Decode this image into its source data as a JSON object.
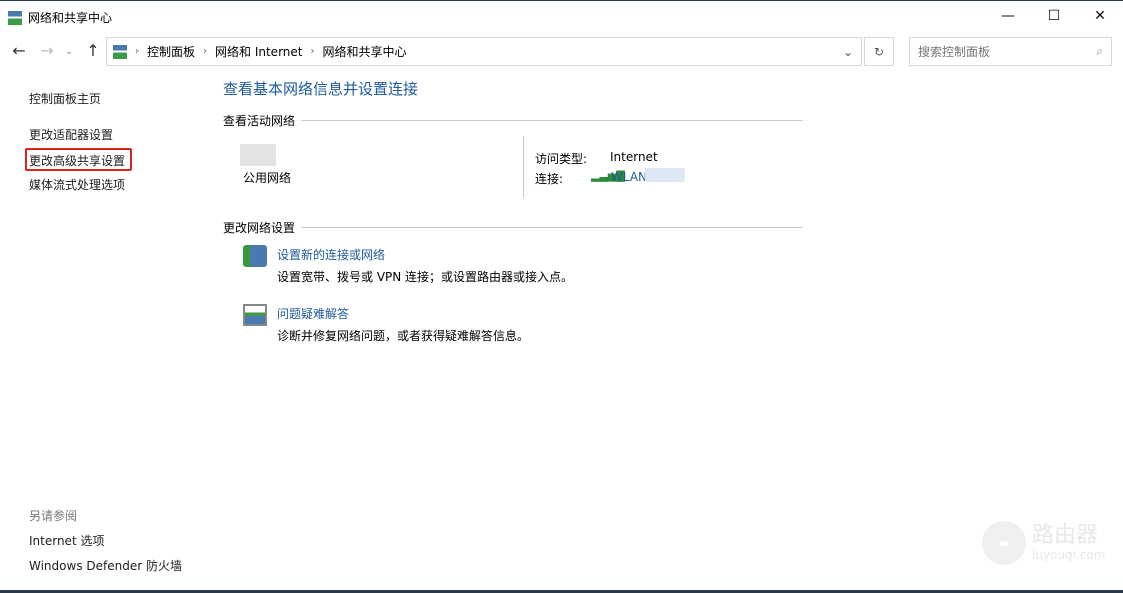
{
  "window": {
    "title": "网络和共享中心",
    "minimize": "—",
    "maximize": "☐",
    "close": "✕"
  },
  "address": {
    "crumbs": [
      "控制面板",
      "网络和 Internet",
      "网络和共享中心"
    ],
    "search_placeholder": "搜索控制面板"
  },
  "sidebar": {
    "items": [
      "控制面板主页",
      "更改适配器设置",
      "更改高级共享设置",
      "媒体流式处理选项"
    ],
    "see_also": "另请参阅",
    "see_also_items": [
      "Internet 选项",
      "Windows Defender 防火墙"
    ]
  },
  "main": {
    "title": "查看基本网络信息并设置连接",
    "active_section": "查看活动网络",
    "network_type": "公用网络",
    "access_label": "访问类型:",
    "access_value": "Internet",
    "conn_label": "连接:",
    "conn_value": "WLAN",
    "change_section": "更改网络设置",
    "tasks": [
      {
        "title": "设置新的连接或网络",
        "desc": "设置宽带、拨号或 VPN 连接；或设置路由器或接入点。"
      },
      {
        "title": "问题疑难解答",
        "desc": "诊断并修复网络问题，或者获得疑难解答信息。"
      }
    ]
  },
  "watermark": {
    "name": "路由器",
    "site": "luyouqi.com"
  }
}
